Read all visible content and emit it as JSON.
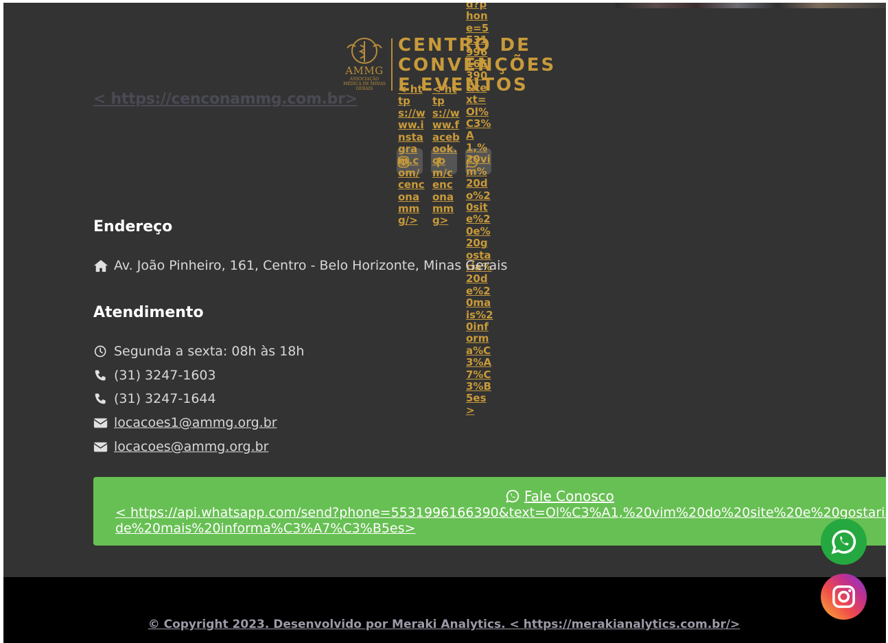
{
  "logo": {
    "mark_text": "AMMG",
    "mark_subtext": "ASSOCIAÇÃO MÉDICA DE MINAS GERAIS",
    "line1": "CENTRO DE",
    "line2": "CONVENÇÕES",
    "line3": "E EVENTOS"
  },
  "site_link": "< https://cenconammg.com.br>",
  "social": {
    "instagram_url": "< https://www.instagram.com/cenconammg/>",
    "facebook_url": "< https://www.facebook.com/cenconammg>",
    "whatsapp_url": "d?phone=5531996166390&text=Ol%C3%A1,%20vim%20do%20site%20e%20gostaria%20de%20mais%20informa%C3%A7%C3%B5es>"
  },
  "address": {
    "heading": "Endereço",
    "text": "Av. João Pinheiro, 161, Centro - Belo Horizonte, Minas Gerais"
  },
  "service": {
    "heading": "Atendimento",
    "hours": "Segunda a sexta: 08h às 18h",
    "phone1": "(31) 3247-1603",
    "phone2": "(31) 3247-1644",
    "email1": "locacoes1@ammg.org.br",
    "email2": "locacoes@ammg.org.br"
  },
  "cta": {
    "label": "Fale Conosco",
    "url": "< https://api.whatsapp.com/send?phone=5531996166390&text=Ol%C3%A1,%20vim%20do%20site%20e%20gostaria%20de%20mais%20informa%C3%A7%C3%B5es>"
  },
  "footer": {
    "copyright": "© Copyright 2023. Desenvolvido por Meraki Analytics. < https://merakianalytics.com.br/>"
  },
  "colors": {
    "accent_gold": "#c89a3a",
    "cta_green": "#67c053",
    "background": "#333333"
  }
}
